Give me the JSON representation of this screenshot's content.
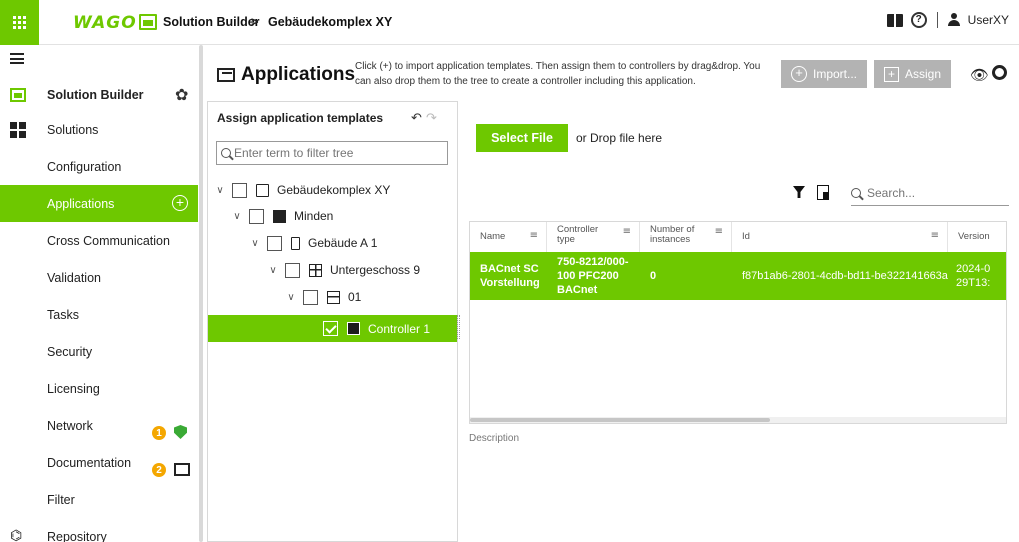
{
  "topbar": {
    "logo": "WAGO",
    "breadcrumb": [
      "Solution Builder",
      "Gebäudekomplex XY"
    ],
    "separator": ">",
    "help_glyph": "?",
    "user": "UserXY",
    "icons": [
      "apps-grid-icon",
      "book-icon",
      "help-icon",
      "user-icon"
    ]
  },
  "sidebar": {
    "title": "Solution Builder",
    "gear_glyph": "✿",
    "items": [
      {
        "label": "Solutions"
      },
      {
        "label": "Configuration"
      },
      {
        "label": "Applications",
        "active": true
      },
      {
        "label": "Cross Communication"
      },
      {
        "label": "Validation"
      },
      {
        "label": "Tasks"
      },
      {
        "label": "Security"
      },
      {
        "label": "Licensing",
        "badge": "1"
      },
      {
        "label": "Network",
        "badge": "2"
      },
      {
        "label": "Documentation"
      },
      {
        "label": "Filter"
      },
      {
        "label": "Repository"
      }
    ],
    "repo_glyph": "⌬",
    "colors": {
      "accent": "#6ec800",
      "badge": "#f4a700",
      "shield": "#3aaa35"
    }
  },
  "header": {
    "title": "Applications",
    "help_text": "Click (+) to import application templates. Then assign them to controllers by drag&drop. You can also drop them to the tree to create a controller including this application.",
    "import_label": "Import...",
    "assign_label": "Assign",
    "eye_glyph": "👁"
  },
  "tree": {
    "title": "Assign application templates",
    "undo_glyph": "↶",
    "redo_glyph": "↷",
    "chevron_glyph": "∨",
    "filter_placeholder": "Enter term to filter tree",
    "nodes": [
      {
        "label": "Gebäudekomplex XY",
        "icon": "document-icon"
      },
      {
        "label": "Minden",
        "icon": "building-icon"
      },
      {
        "label": "Gebäude A 1",
        "icon": "device-icon"
      },
      {
        "label": "Untergeschoss 9",
        "icon": "floor-icon"
      },
      {
        "label": "01",
        "icon": "cabinet-icon"
      },
      {
        "label": "Controller 1",
        "icon": "controller-icon",
        "checked": true,
        "selected": true
      }
    ]
  },
  "main": {
    "select_file_label": "Select File",
    "drop_text": "or Drop file here",
    "search_placeholder": "Search...",
    "sort_glyph": "≡",
    "table": {
      "headers": [
        "Name",
        "Controller type",
        "Number of instances",
        "Id",
        "Version"
      ],
      "rows": [
        {
          "name": "BACnet SC Vorstellung",
          "controller_type": "750-8212/000-100 PFC200 BACnet",
          "instances": "0",
          "id": "f87b1ab6-2801-4cdb-bd11-be322141663a",
          "version": "2024-0 29T13:"
        }
      ]
    },
    "description_label": "Description"
  }
}
